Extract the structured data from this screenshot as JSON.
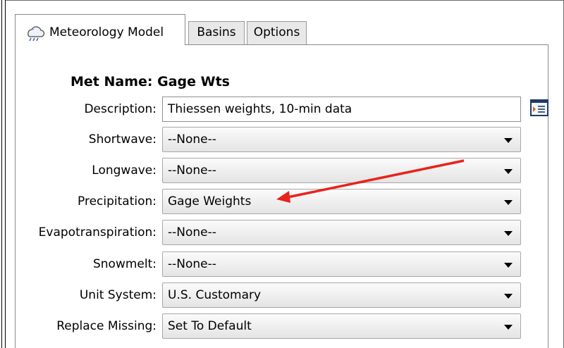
{
  "tabs": [
    {
      "label": "Meteorology Model",
      "active": true,
      "icon": "cloud-rain-icon"
    },
    {
      "label": "Basins",
      "active": false
    },
    {
      "label": "Options",
      "active": false
    }
  ],
  "met_name": "Met Name: Gage Wts",
  "fields": {
    "description": {
      "label": "Description:",
      "value": "Thiessen weights, 10-min data"
    },
    "shortwave": {
      "label": "Shortwave:",
      "value": "--None--"
    },
    "longwave": {
      "label": "Longwave:",
      "value": "--None--"
    },
    "precipitation": {
      "label": "Precipitation:",
      "value": "Gage Weights"
    },
    "evapotranspiration": {
      "label": "Evapotranspiration:",
      "value": "--None--"
    },
    "snowmelt": {
      "label": "Snowmelt:",
      "value": "--None--"
    },
    "unit_system": {
      "label": "Unit System:",
      "value": "U.S. Customary"
    },
    "replace_missing": {
      "label": "Replace Missing:",
      "value": "Set To Default"
    }
  },
  "annotation_arrow_color": "#e8231d",
  "icons": {
    "edit_description": "text-editor-icon"
  }
}
